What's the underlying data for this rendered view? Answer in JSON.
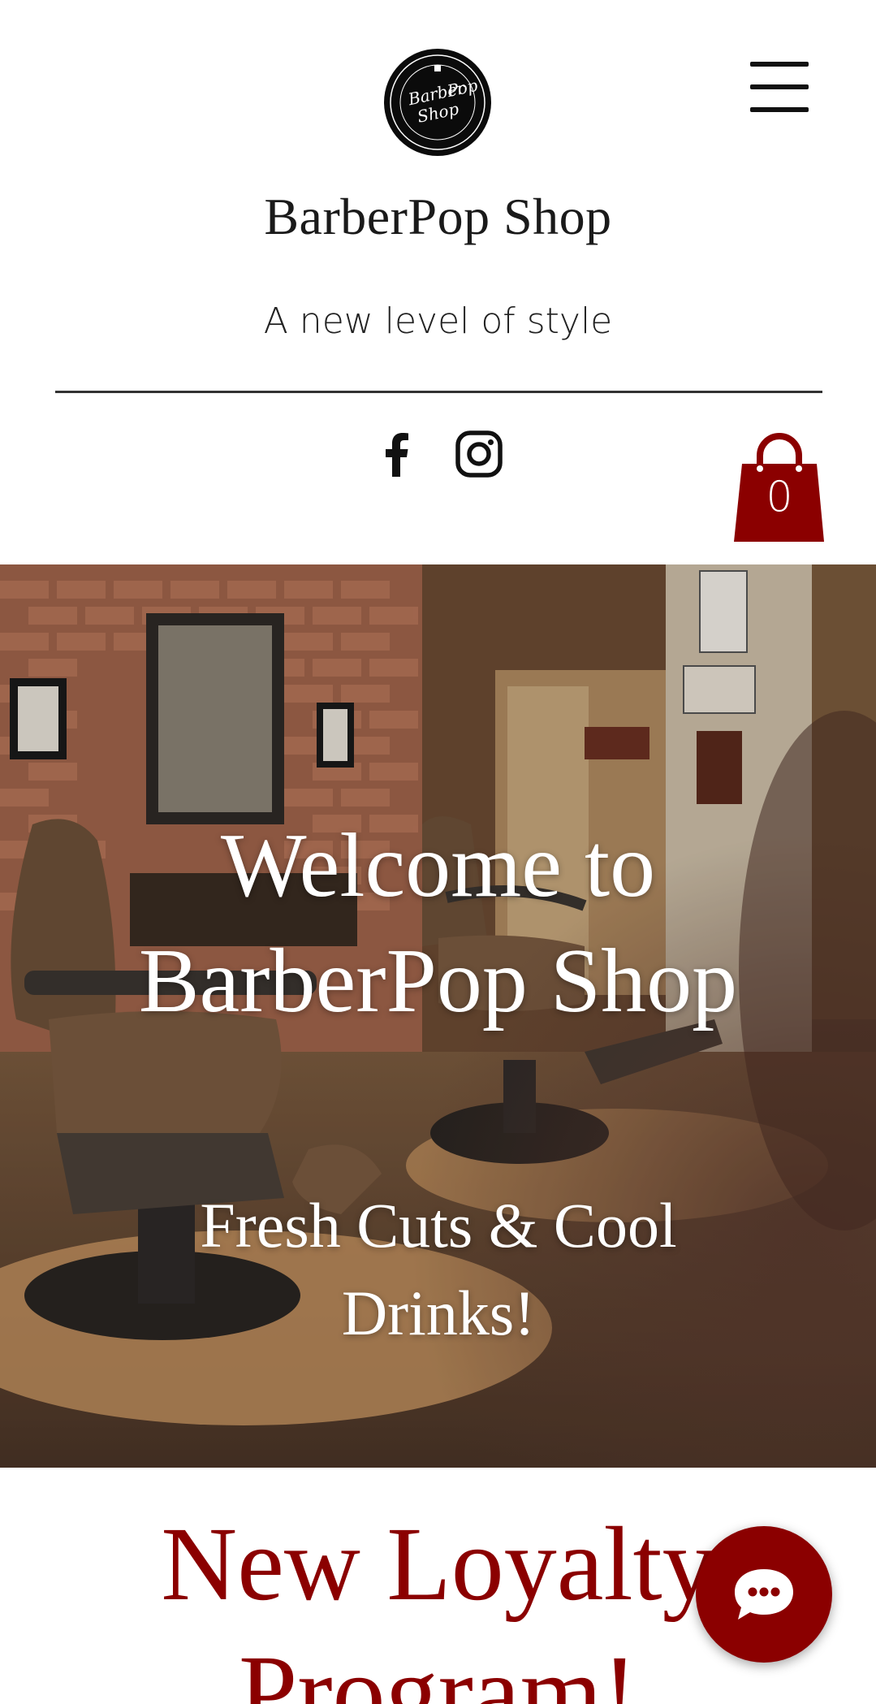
{
  "header": {
    "logo": {
      "text_top": "Barber",
      "text_bottom": "Pop",
      "text_last": "Shop"
    },
    "site_title": "BarberPop Shop",
    "tagline": "A new level of style",
    "social": [
      {
        "name": "facebook",
        "icon": "facebook-icon"
      },
      {
        "name": "instagram",
        "icon": "instagram-icon"
      }
    ],
    "cart": {
      "count": "0",
      "color": "#8b0000"
    },
    "menu_icon": "hamburger-menu-icon"
  },
  "hero": {
    "title_line1": "Welcome to",
    "title_line2": "BarberPop Shop",
    "subtitle_line1": "Fresh Cuts & Cool",
    "subtitle_line2": "Drinks!"
  },
  "loyalty": {
    "title_line1": "New Loyalty",
    "title_line2": "Program!",
    "accent_color": "#8b0000"
  },
  "chat": {
    "icon": "chat-bubble-icon"
  }
}
